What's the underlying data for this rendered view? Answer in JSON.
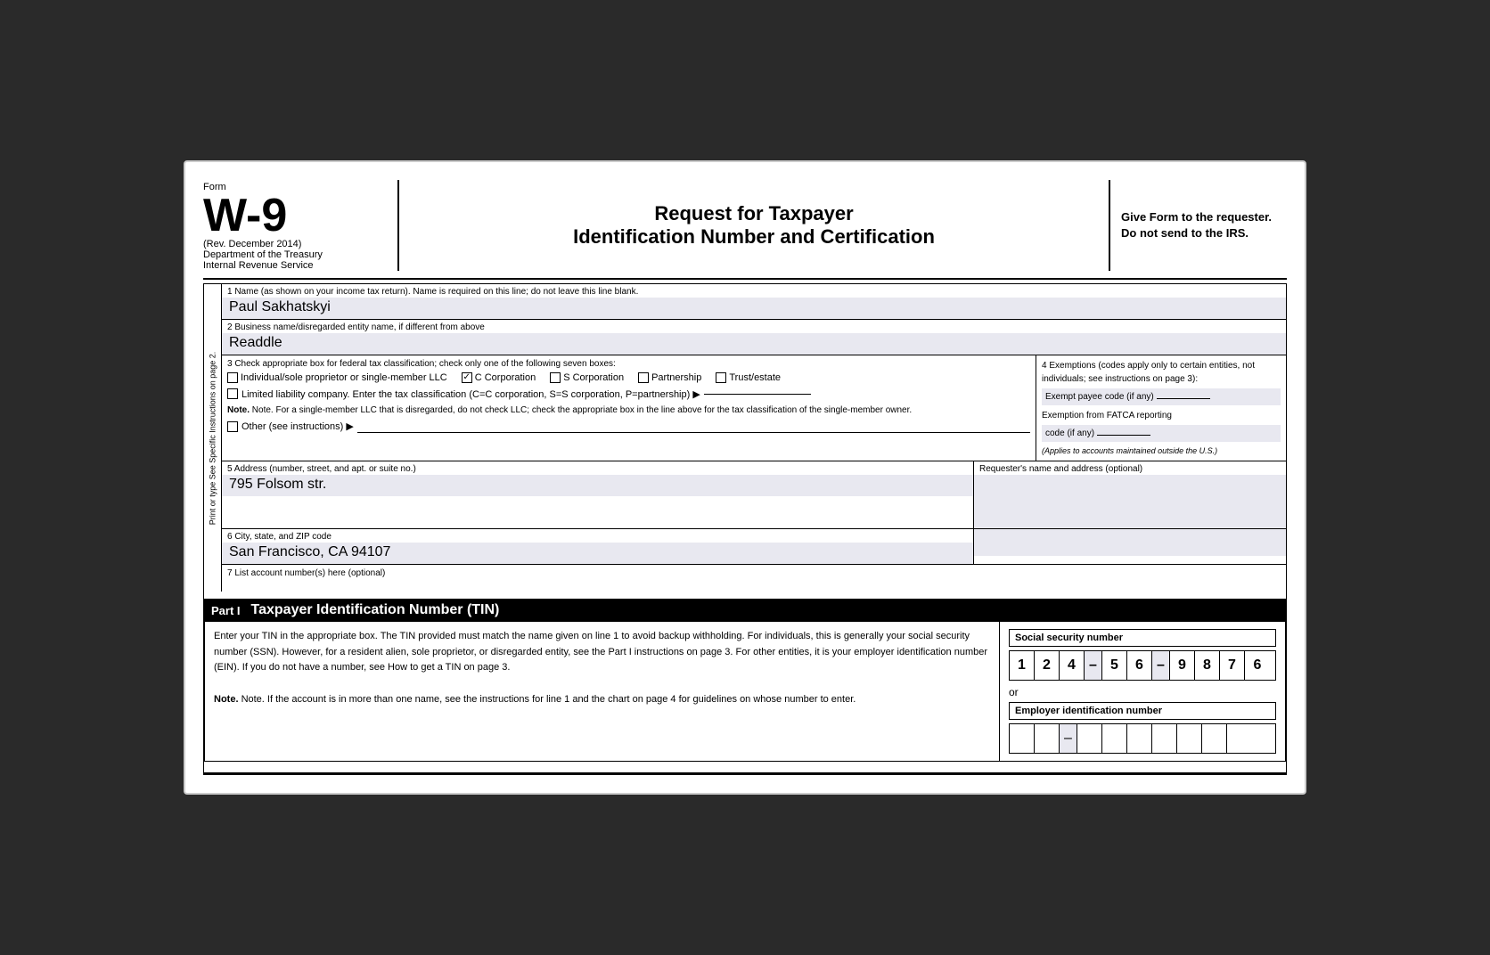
{
  "form": {
    "label": "Form",
    "number": "W-9",
    "rev": "(Rev. December 2014)",
    "dept1": "Department of the Treasury",
    "dept2": "Internal Revenue Service",
    "title_main": "Request for Taxpayer",
    "title_sub": "Identification Number and Certification",
    "give_note": "Give Form to the requester. Do not send to the IRS."
  },
  "fields": {
    "field1_label": "1  Name (as shown on your income tax return). Name is required on this line; do not leave this line blank.",
    "field1_value": "Paul Sakhatskyi",
    "field2_label": "2  Business name/disregarded entity name, if different from above",
    "field2_value": "Readdle",
    "field3_label": "3  Check appropriate box for federal tax classification; check only one of the following seven boxes:",
    "individual_label": "Individual/sole proprietor or single-member LLC",
    "c_corp_label": "C Corporation",
    "s_corp_label": "S Corporation",
    "partnership_label": "Partnership",
    "trust_label": "Trust/estate",
    "llc_label": "Limited liability company. Enter the tax classification (C=C corporation, S=S corporation, P=partnership) ▶",
    "note_text": "Note. For a single-member LLC that is disregarded, do not check LLC; check the appropriate box in the line above for the tax classification of the single-member owner.",
    "other_label": "Other (see instructions) ▶",
    "field4_label": "4  Exemptions (codes apply only to certain entities, not individuals; see instructions on page 3):",
    "exempt_payee_label": "Exempt payee code (if any)",
    "fatca_label": "Exemption from FATCA reporting",
    "fatca_label2": "code (if any)",
    "fatca_note": "(Applies to accounts maintained outside the U.S.)",
    "field5_label": "5  Address (number, street, and apt. or suite no.)",
    "field5_value": "795 Folsom str.",
    "requester_label": "Requester's name and address (optional)",
    "field6_label": "6  City, state, and ZIP code",
    "field6_value": "San Francisco, CA 94107",
    "field7_label": "7  List account number(s) here (optional)",
    "sidebar_text": "Print or type    See Specific Instructions on page 2."
  },
  "part1": {
    "part_label": "Part I",
    "part_title": "Taxpayer Identification Number (TIN)",
    "instructions": "Enter your TIN in the appropriate box. The TIN provided must match the name given on line 1 to avoid backup withholding. For individuals, this is generally your social security number (SSN). However, for a resident alien, sole proprietor, or disregarded entity, see the Part I instructions on page 3. For other entities, it is your employer identification number (EIN). If you do not have a number, see How to get a TIN on page 3.",
    "note": "Note. If the account is in more than one name, see the instructions for line 1 and the chart on page 4 for guidelines on whose number to enter.",
    "ssn_label": "Social security number",
    "ssn_digits": [
      "1",
      "2",
      "4",
      "–",
      "5",
      "6",
      "–",
      "9",
      "8",
      "7",
      "6"
    ],
    "or_text": "or",
    "ein_label": "Employer identification number",
    "ein_digits": [
      "",
      "",
      "–",
      "",
      "",
      "",
      "",
      "",
      ""
    ]
  }
}
